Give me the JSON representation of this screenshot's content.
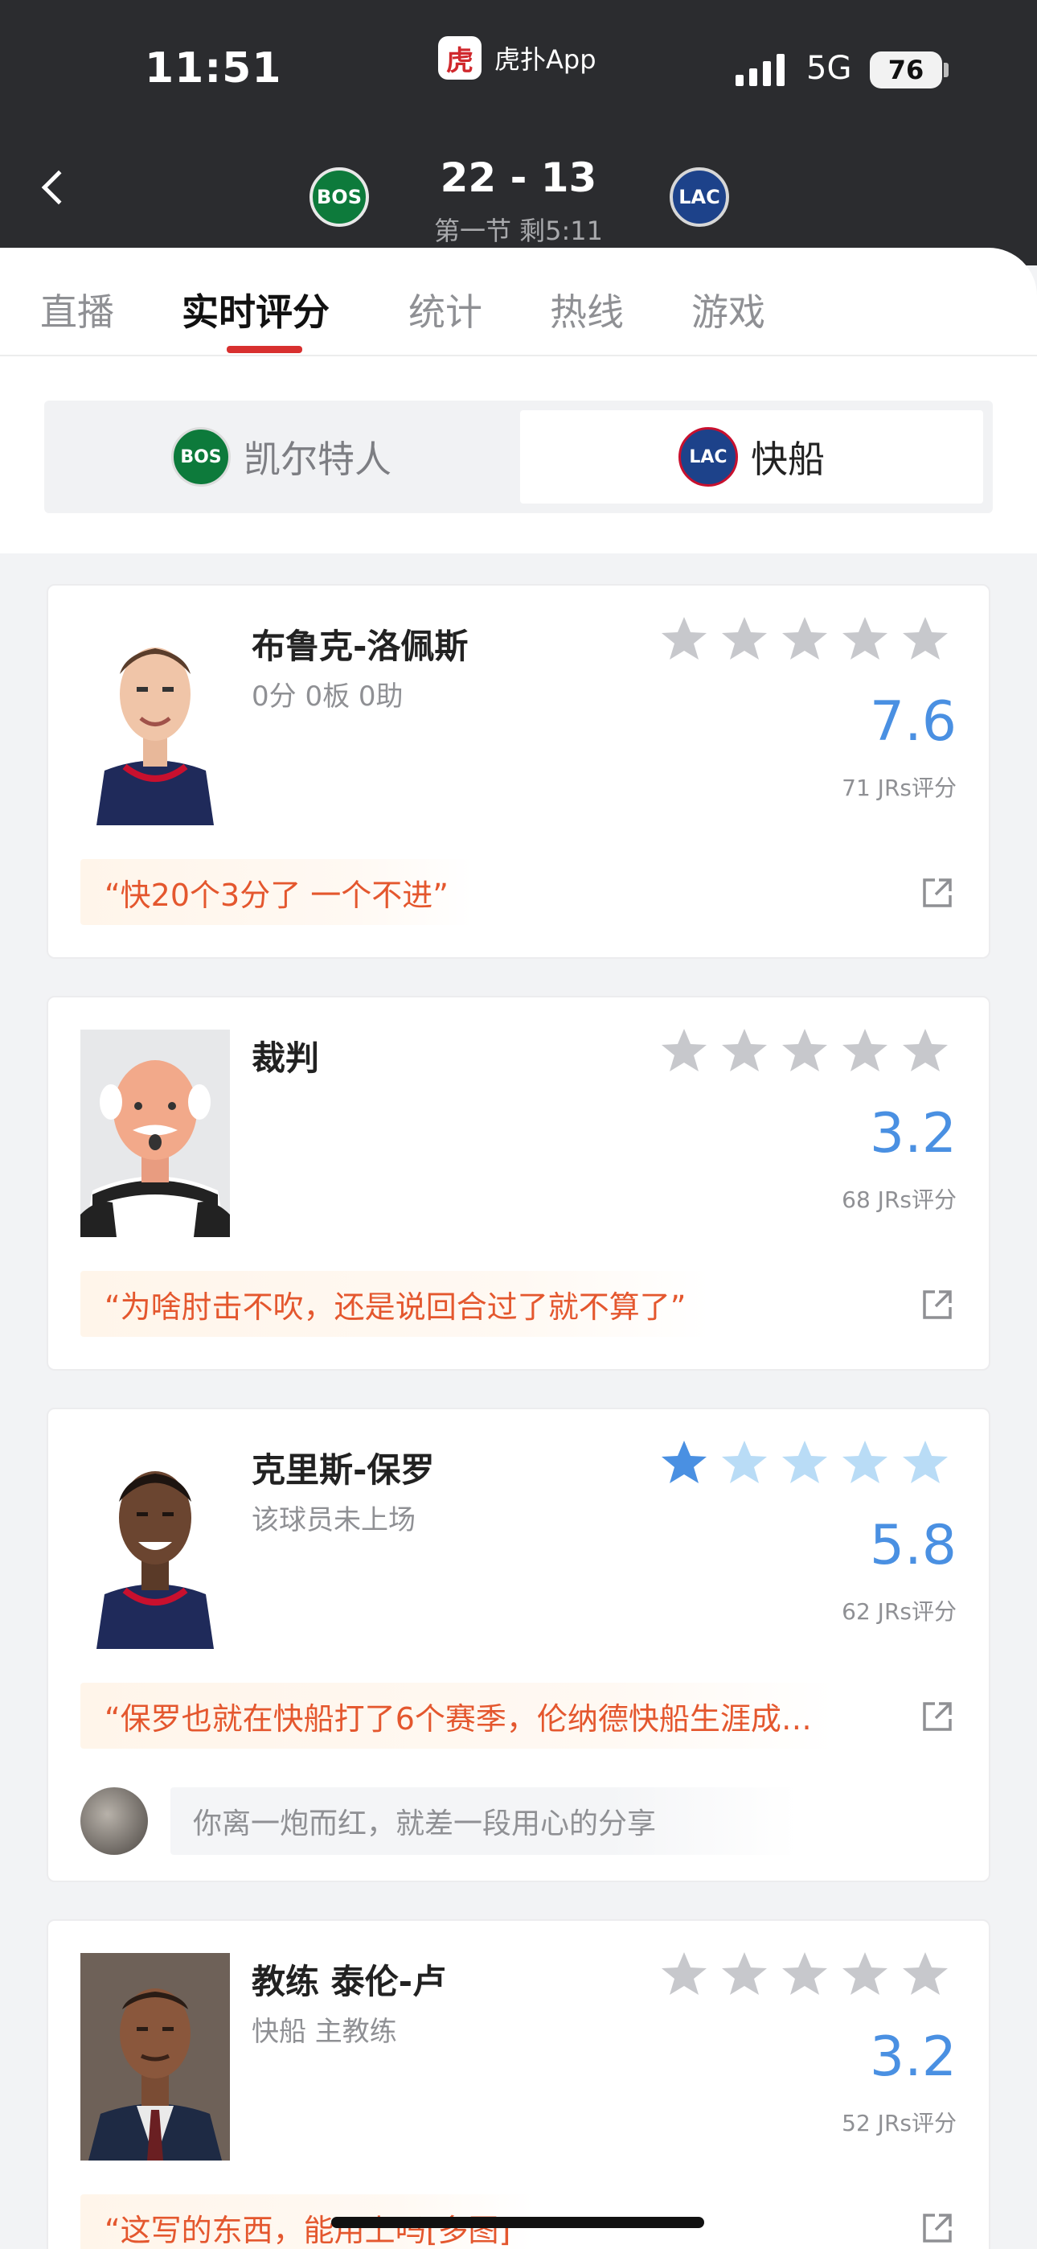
{
  "status_bar": {
    "time": "11:51",
    "app_name": "虎扑App",
    "app_logo_glyph": "虎",
    "network": "5G",
    "battery": "76",
    "battery_level": 0.76
  },
  "game": {
    "score": "22 - 13",
    "period": "第一节 剩5:11",
    "home_logo_text": "BOS",
    "away_logo_text": "LAC"
  },
  "tabs": [
    {
      "label": "直播"
    },
    {
      "label": "实时评分"
    },
    {
      "label": "统计"
    },
    {
      "label": "热线"
    },
    {
      "label": "游戏"
    }
  ],
  "active_tab": "实时评分",
  "team_switch": {
    "left": {
      "name": "凯尔特人",
      "logo_text": "BOS"
    },
    "right": {
      "name": "快船",
      "logo_text": "LAC"
    },
    "selected": "快船"
  },
  "cards": [
    {
      "name": "布鲁克-洛佩斯",
      "subtitle": "0分 0板 0助",
      "rating": "7.6",
      "votes": "71 JRs评分",
      "user_stars": 0,
      "quote": "“快20个3分了 一个不进”"
    },
    {
      "name": "裁判",
      "subtitle": "",
      "rating": "3.2",
      "votes": "68 JRs评分",
      "user_stars": 0,
      "quote": "“为啥肘击不吹，还是说回合过了就不算了”"
    },
    {
      "name": "克里斯-保罗",
      "subtitle": "该球员未上场",
      "rating": "5.8",
      "votes": "62 JRs评分",
      "user_stars": 1,
      "quote": "“保罗也就在快船打了6个赛季，伦纳德快船生涯成…",
      "comment_placeholder": "你离一炮而红，就差一段用心的分享"
    },
    {
      "name": "教练 泰伦-卢",
      "subtitle": "快船 主教练",
      "rating": "3.2",
      "votes": "52 JRs评分",
      "user_stars": 0,
      "quote": "“这写的东西，能用上吗[多图]"
    }
  ],
  "colors": {
    "accent_blue": "#4a90e2",
    "quote_orange": "#e4572e",
    "tab_red": "#d8302f",
    "header_dark": "#2b2c2f"
  }
}
